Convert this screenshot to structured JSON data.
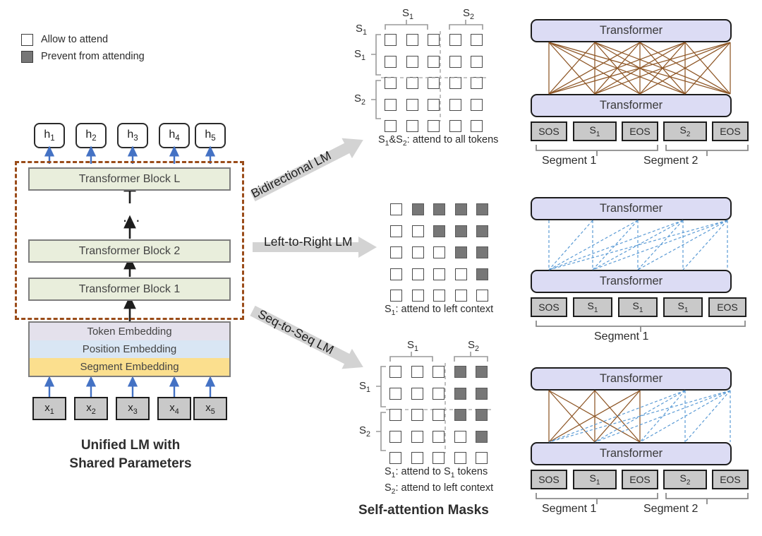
{
  "legend": {
    "items": [
      {
        "label": "Allow to attend",
        "swatch": "allow"
      },
      {
        "label": "Prevent from attending",
        "swatch": "prevent"
      }
    ]
  },
  "unified_lm": {
    "outputs": [
      "h1",
      "h2",
      "h3",
      "h4",
      "h5"
    ],
    "blocks": [
      "Transformer Block L",
      "Transformer Block 2",
      "Transformer Block 1"
    ],
    "ellipsis": "...",
    "embeddings": [
      "Token Embedding",
      "Position Embedding",
      "Segment Embedding"
    ],
    "inputs": [
      "x1",
      "x2",
      "x3",
      "x4",
      "x5"
    ],
    "caption_line1": "Unified LM with",
    "caption_line2": "Shared Parameters"
  },
  "flows": [
    {
      "label": "Bidirectional LM"
    },
    {
      "label": "Left-to-Right LM"
    },
    {
      "label": "Seq-to-Seq LM"
    }
  ],
  "masks_title": "Self-attention Masks",
  "masks": [
    {
      "name": "bidirectional",
      "col_groups": [
        "S1",
        "S2"
      ],
      "row_groups": [
        "S1",
        "S2"
      ],
      "grid": [
        [
          1,
          1,
          1,
          1,
          1
        ],
        [
          1,
          1,
          1,
          1,
          1
        ],
        [
          1,
          1,
          1,
          1,
          1
        ],
        [
          1,
          1,
          1,
          1,
          1
        ],
        [
          1,
          1,
          1,
          1,
          1
        ]
      ],
      "captions": [
        "S1&S2: attend to all tokens"
      ]
    },
    {
      "name": "left-to-right",
      "col_groups": [],
      "row_groups": [],
      "grid": [
        [
          1,
          0,
          0,
          0,
          0
        ],
        [
          1,
          1,
          0,
          0,
          0
        ],
        [
          1,
          1,
          1,
          0,
          0
        ],
        [
          1,
          1,
          1,
          1,
          0
        ],
        [
          1,
          1,
          1,
          1,
          1
        ]
      ],
      "captions": [
        "S1: attend to left context"
      ]
    },
    {
      "name": "seq-to-seq",
      "col_groups": [
        "S1",
        "S2"
      ],
      "row_groups": [
        "S1",
        "S2"
      ],
      "grid": [
        [
          1,
          1,
          1,
          0,
          0
        ],
        [
          1,
          1,
          1,
          0,
          0
        ],
        [
          1,
          1,
          1,
          0,
          0
        ],
        [
          1,
          1,
          1,
          1,
          0
        ],
        [
          1,
          1,
          1,
          1,
          1
        ]
      ],
      "captions": [
        "S1: attend to S1 tokens",
        "S2: attend to left context"
      ]
    }
  ],
  "panels": [
    {
      "name": "bidirectional",
      "upper_label": "Transformer",
      "lower_label": "Transformer",
      "tokens": [
        "SOS",
        "S1",
        "EOS",
        "S2",
        "EOS"
      ],
      "segments": [
        "Segment 1",
        "Segment 2"
      ]
    },
    {
      "name": "left-to-right",
      "upper_label": "Transformer",
      "lower_label": "Transformer",
      "tokens": [
        "SOS",
        "S1",
        "S1",
        "S1",
        "EOS"
      ],
      "segments": [
        "Segment 1"
      ]
    },
    {
      "name": "seq-to-seq",
      "upper_label": "Transformer",
      "lower_label": "Transformer",
      "tokens": [
        "SOS",
        "S1",
        "EOS",
        "S2",
        "EOS"
      ],
      "segments": [
        "Segment 1",
        "Segment 2"
      ]
    }
  ],
  "colors": {
    "brown_dash": "#9a4c1a",
    "brown_edge": "#8d5524",
    "blue_edge": "#5b9bd5",
    "blue_arrow": "#4472c4",
    "prevent": "#777777",
    "transformer_fill": "#dcdcf4",
    "block_fill": "#e9eedc",
    "token_fill": "#e4e1ec",
    "position_fill": "#d9e6f4",
    "segment_fill": "#fbdf8e",
    "gray_arrow": "#d3d3d3"
  }
}
